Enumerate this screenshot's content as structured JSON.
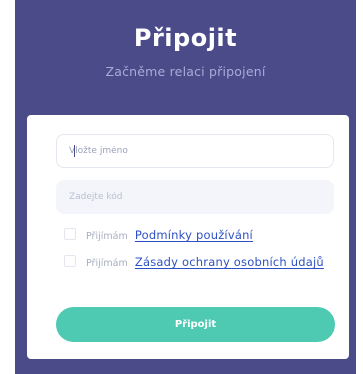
{
  "header": {
    "title": "Připojit",
    "subtitle": "Začněme relaci připojení"
  },
  "form": {
    "name_placeholder": "Vložte jméno",
    "code_placeholder": "Zadejte kód",
    "terms": {
      "accept_label": "Přijímám",
      "link_text": "Podmínky používání"
    },
    "privacy": {
      "accept_label": "Přijímám",
      "link_text": "Zásady ochrany osobních údajů"
    },
    "submit_label": "Připojit"
  },
  "colors": {
    "panel_background": "#4a4b88",
    "subtitle": "#a7acd8",
    "button": "#4ec9b2",
    "link": "#2d51c4"
  }
}
